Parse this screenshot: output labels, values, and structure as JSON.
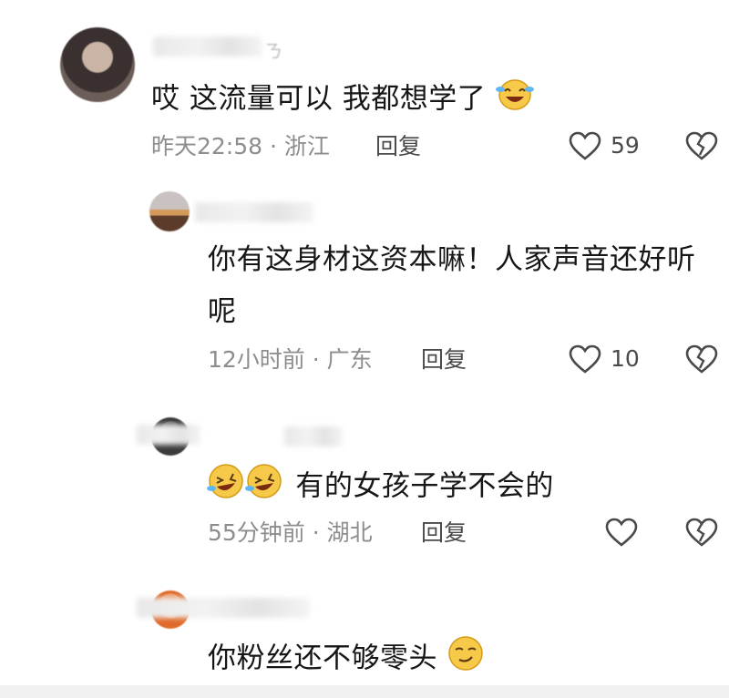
{
  "comments": [
    {
      "text": "哎 这流量可以 我都想学了",
      "emoji": "laughing-tears-emoji",
      "time": "昨天22:58",
      "location": "浙江",
      "reply_label": "回复",
      "likes": "59"
    },
    {
      "text_line1": "你有这身材这资本嘛！人家声音还好听",
      "text_line2": "呢",
      "time": "12小时前",
      "location": "广东",
      "reply_label": "回复",
      "likes": "10"
    },
    {
      "emoji": "rolling-laughing-emoji",
      "text": "有的女孩子学不会的",
      "time": "55分钟前",
      "location": "湖北",
      "reply_label": "回复",
      "likes": ""
    },
    {
      "text": "你粉丝还不够零头",
      "emoji": "smirk-emoji"
    }
  ],
  "separator": "·",
  "colors": {
    "text": "#161616",
    "meta": "#8d8d8d",
    "icon": "#4a4a4a",
    "emoji": "#f7c948"
  }
}
